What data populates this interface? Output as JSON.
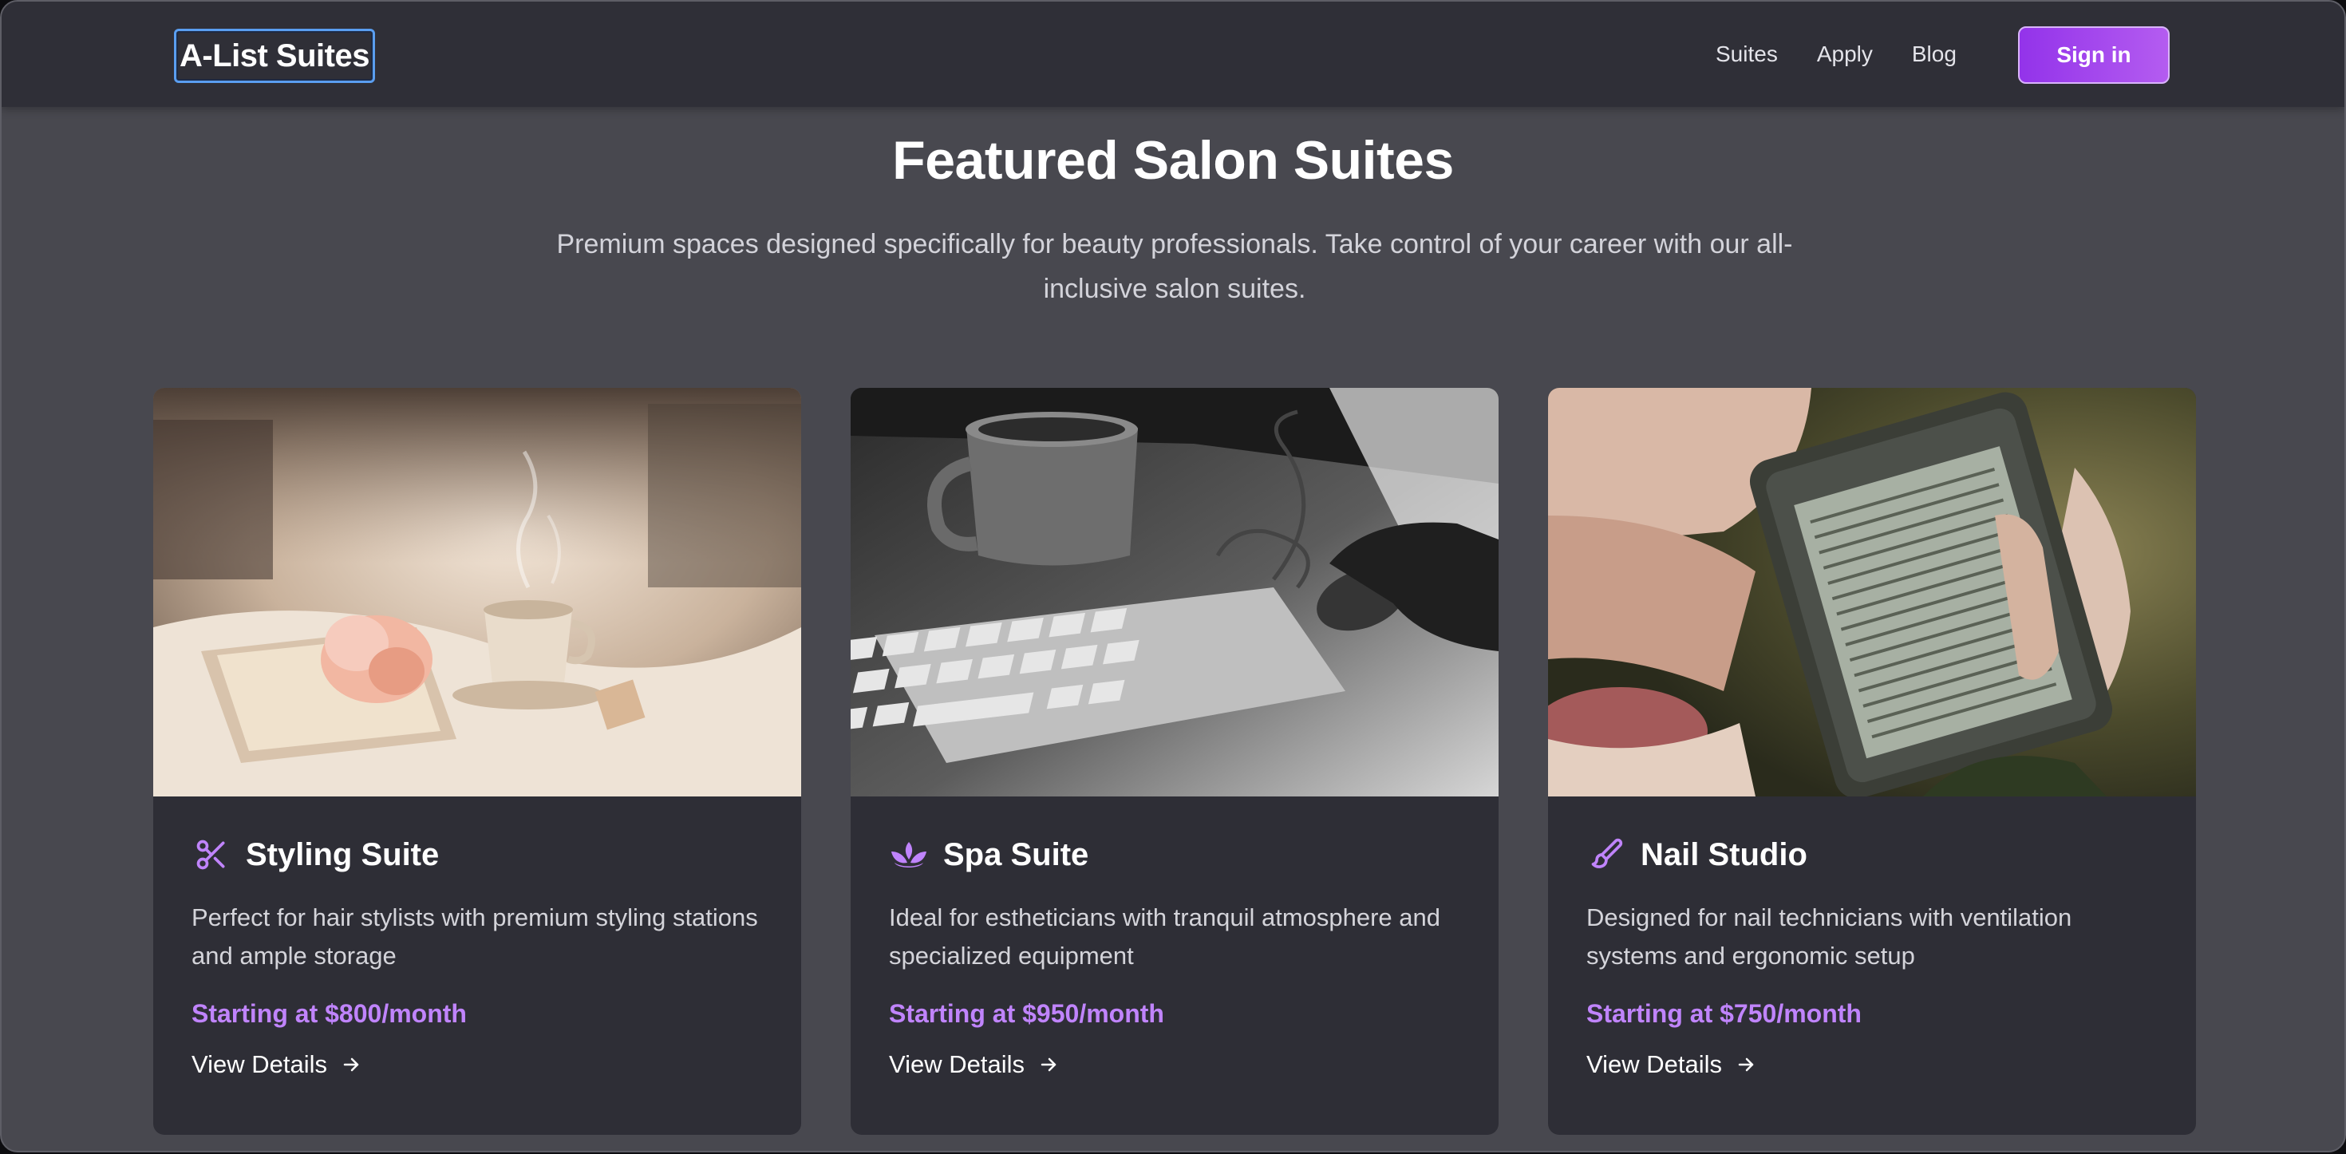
{
  "header": {
    "logo": "A-List Suites",
    "nav": [
      "Suites",
      "Apply",
      "Blog"
    ],
    "signin_label": "Sign in"
  },
  "hero": {
    "title": "Featured Salon Suites",
    "subtitle": "Premium spaces designed specifically for beauty professionals. Take control of your career with our all-inclusive salon suites."
  },
  "cards": [
    {
      "icon": "scissors-icon",
      "title": "Styling Suite",
      "description": "Perfect for hair stylists with premium styling stations and ample storage",
      "price": "Starting at $800/month",
      "link": "View Details",
      "image": "tea-cup-and-book-photo"
    },
    {
      "icon": "lotus-icon",
      "title": "Spa Suite",
      "description": "Ideal for estheticians with tranquil atmosphere and specialized equipment",
      "price": "Starting at $950/month",
      "link": "View Details",
      "image": "mug-keyboard-mouse-photo"
    },
    {
      "icon": "paintbrush-icon",
      "title": "Nail Studio",
      "description": "Designed for nail technicians with ventilation systems and ergonomic setup",
      "price": "Starting at $750/month",
      "link": "View Details",
      "image": "kindle-ereader-photo"
    }
  ],
  "colors": {
    "accent": "#c084fc",
    "button_gradient_start": "#9333ea",
    "button_gradient_end": "#b45cf0",
    "page_bg": "#48484f",
    "header_bg": "#2f2f37",
    "card_bg": "#2e2e36"
  }
}
